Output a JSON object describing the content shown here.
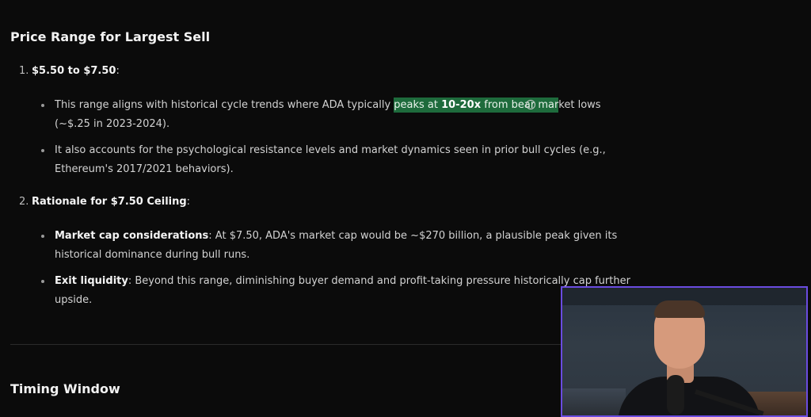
{
  "section1": {
    "title": "Price Range for Largest Sell",
    "item1": {
      "number": "1.",
      "label": "$5.50 to $7.50",
      "suffix": ":",
      "bullets": [
        {
          "pre": "This range aligns with historical cycle trends where ADA typically ",
          "hl_pre": "peaks at ",
          "hl_bold": "10-20x",
          "hl_post": " from bear mar",
          "post": "ket lows",
          "line2": "(~$.25 in 2023-2024)."
        },
        {
          "line1": "It also accounts for the psychological resistance levels and market dynamics seen in prior bull cycles (e.g.,",
          "line2": "Ethereum's 2017/2021 behaviors)."
        }
      ]
    },
    "item2": {
      "number": "2.",
      "label": "Rationale for $7.50 Ceiling",
      "suffix": ":",
      "bullets": [
        {
          "bold": "Market cap considerations",
          "line1": ": At $7.50, ADA's market cap would be ~$270 billion, a plausible peak given its",
          "line2": "historical dominance during bull runs."
        },
        {
          "bold": "Exit liquidity",
          "line1": ": Beyond this range, diminishing buyer demand and profit-taking pressure historically cap further",
          "line2": "upside."
        }
      ]
    }
  },
  "section2": {
    "title": "Timing Window"
  },
  "colors": {
    "background": "#0b0b0b",
    "highlight": "#1e6b3c",
    "webcam_border": "#6a4be0"
  }
}
